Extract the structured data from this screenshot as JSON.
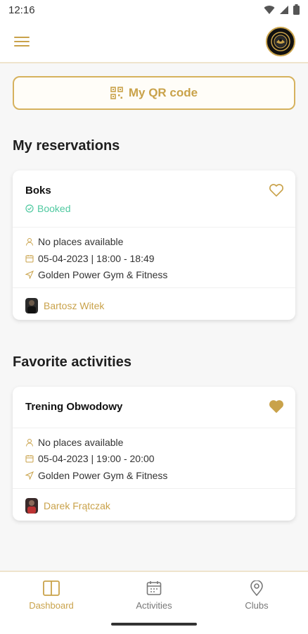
{
  "status_bar": {
    "time": "12:16",
    "icons": [
      "wifi-icon",
      "signal-icon",
      "battery-icon"
    ]
  },
  "header": {
    "menu_icon": "hamburger-menu-icon",
    "avatar_icon": "gym-logo-avatar"
  },
  "qr": {
    "label": "My QR code",
    "icon": "qr-code-icon"
  },
  "reservations": {
    "title": "My reservations",
    "card": {
      "title": "Boks",
      "status": "Booked",
      "places": "No places available",
      "datetime": "05-04-2023 | 18:00 - 18:49",
      "location": "Golden Power Gym & Fitness",
      "trainer": "Bartosz Witek",
      "favorite": false
    }
  },
  "favorites": {
    "title": "Favorite activities",
    "card": {
      "title": "Trening Obwodowy",
      "places": "No places available",
      "datetime": "05-04-2023 | 19:00 - 20:00",
      "location": "Golden Power Gym & Fitness",
      "trainer": "Darek Frątczak",
      "favorite": true
    }
  },
  "bottom_nav": {
    "items": [
      {
        "label": "Dashboard",
        "icon": "dashboard-icon",
        "active": true
      },
      {
        "label": "Activities",
        "icon": "calendar-icon",
        "active": false
      },
      {
        "label": "Clubs",
        "icon": "location-pin-icon",
        "active": false
      }
    ]
  },
  "colors": {
    "accent": "#c9a24a",
    "booked": "#4fc9a0",
    "background": "#f7f7f7"
  }
}
